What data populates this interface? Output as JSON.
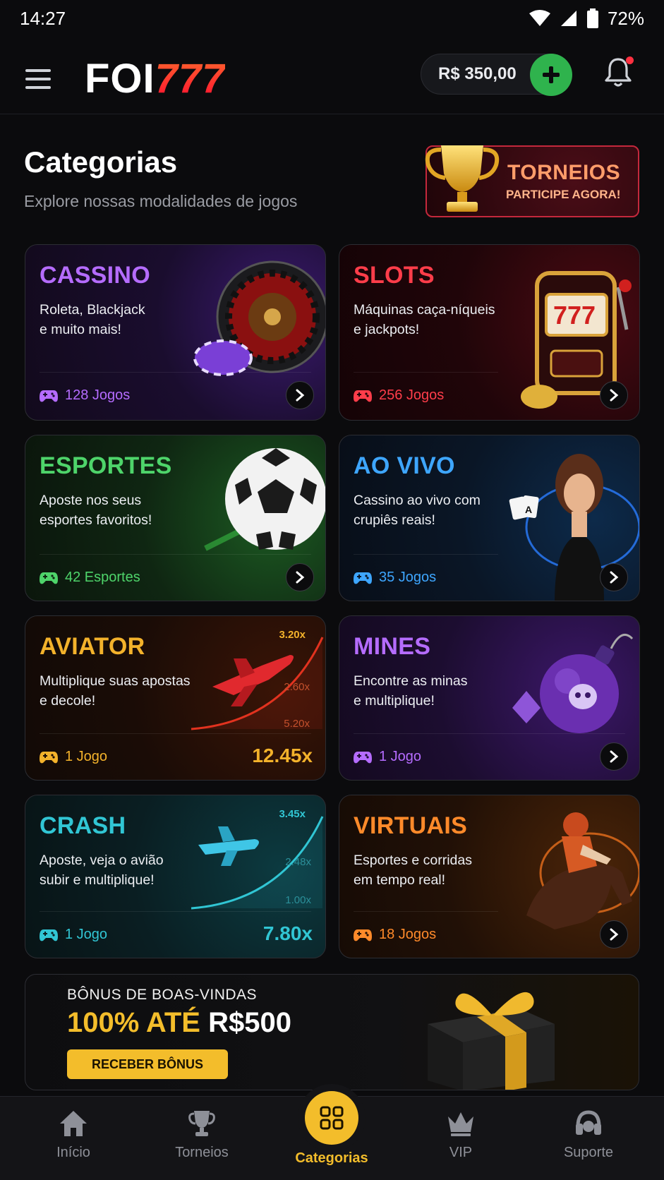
{
  "status_bar": {
    "time": "14:27",
    "battery": "72%"
  },
  "header": {
    "logo_left": "FOI",
    "logo_right": "777",
    "balance": "R$ 350,00"
  },
  "page": {
    "title": "Categorias",
    "subtitle": "Explore nossas modalidades de jogos"
  },
  "tournament_banner": {
    "title": "TORNEIOS",
    "subtitle": "PARTICIPE AGORA!"
  },
  "categories": [
    {
      "title": "CASSINO",
      "desc_1": "Roleta, Blackjack",
      "desc_2": "e muito mais!",
      "count": "128 Jogos",
      "color": "#b56cff"
    },
    {
      "title": "SLOTS",
      "desc_1": "Máquinas caça-níqueis",
      "desc_2": "e jackpots!",
      "count": "256 Jogos",
      "color": "#ff3d4a"
    },
    {
      "title": "ESPORTES",
      "desc_1": "Aposte nos seus",
      "desc_2": "esportes favoritos!",
      "count": "42 Esportes",
      "color": "#4ed46a"
    },
    {
      "title": "AO VIVO",
      "desc_1": "Cassino ao vivo com",
      "desc_2": "crupiês reais!",
      "count": "35 Jogos",
      "color": "#3ea6ff"
    },
    {
      "title": "AVIATOR",
      "desc_1": "Multiplique suas apostas",
      "desc_2": "e decole!",
      "count": "1 Jogo",
      "multiplier": "12.45x",
      "chart_labels": [
        "3.20x",
        "2.60x",
        "5.20x"
      ],
      "color": "#f3b22b"
    },
    {
      "title": "MINES",
      "desc_1": "Encontre as minas",
      "desc_2": "e multiplique!",
      "count": "1 Jogo",
      "color": "#b56cff"
    },
    {
      "title": "CRASH",
      "desc_1": "Aposte, veja o avião",
      "desc_2": "subir e multiplique!",
      "count": "1 Jogo",
      "multiplier": "7.80x",
      "chart_labels": [
        "3.45x",
        "2.48x",
        "1.00x"
      ],
      "color": "#31c6d4"
    },
    {
      "title": "VIRTUAIS",
      "desc_1": "Esportes e corridas",
      "desc_2": "em tempo real!",
      "count": "18 Jogos",
      "color": "#ff8a2a"
    }
  ],
  "bonus": {
    "small": "BÔNUS DE BOAS-VINDAS",
    "big_gold": "100% ATÉ",
    "big_white": "R$500",
    "button": "RECEBER BÔNUS"
  },
  "bottom_nav": {
    "home": "Início",
    "tournaments": "Torneios",
    "categories": "Categorias",
    "vip": "VIP",
    "support": "Suporte",
    "active": "Categorias",
    "active_color": "#f3bd2b"
  }
}
